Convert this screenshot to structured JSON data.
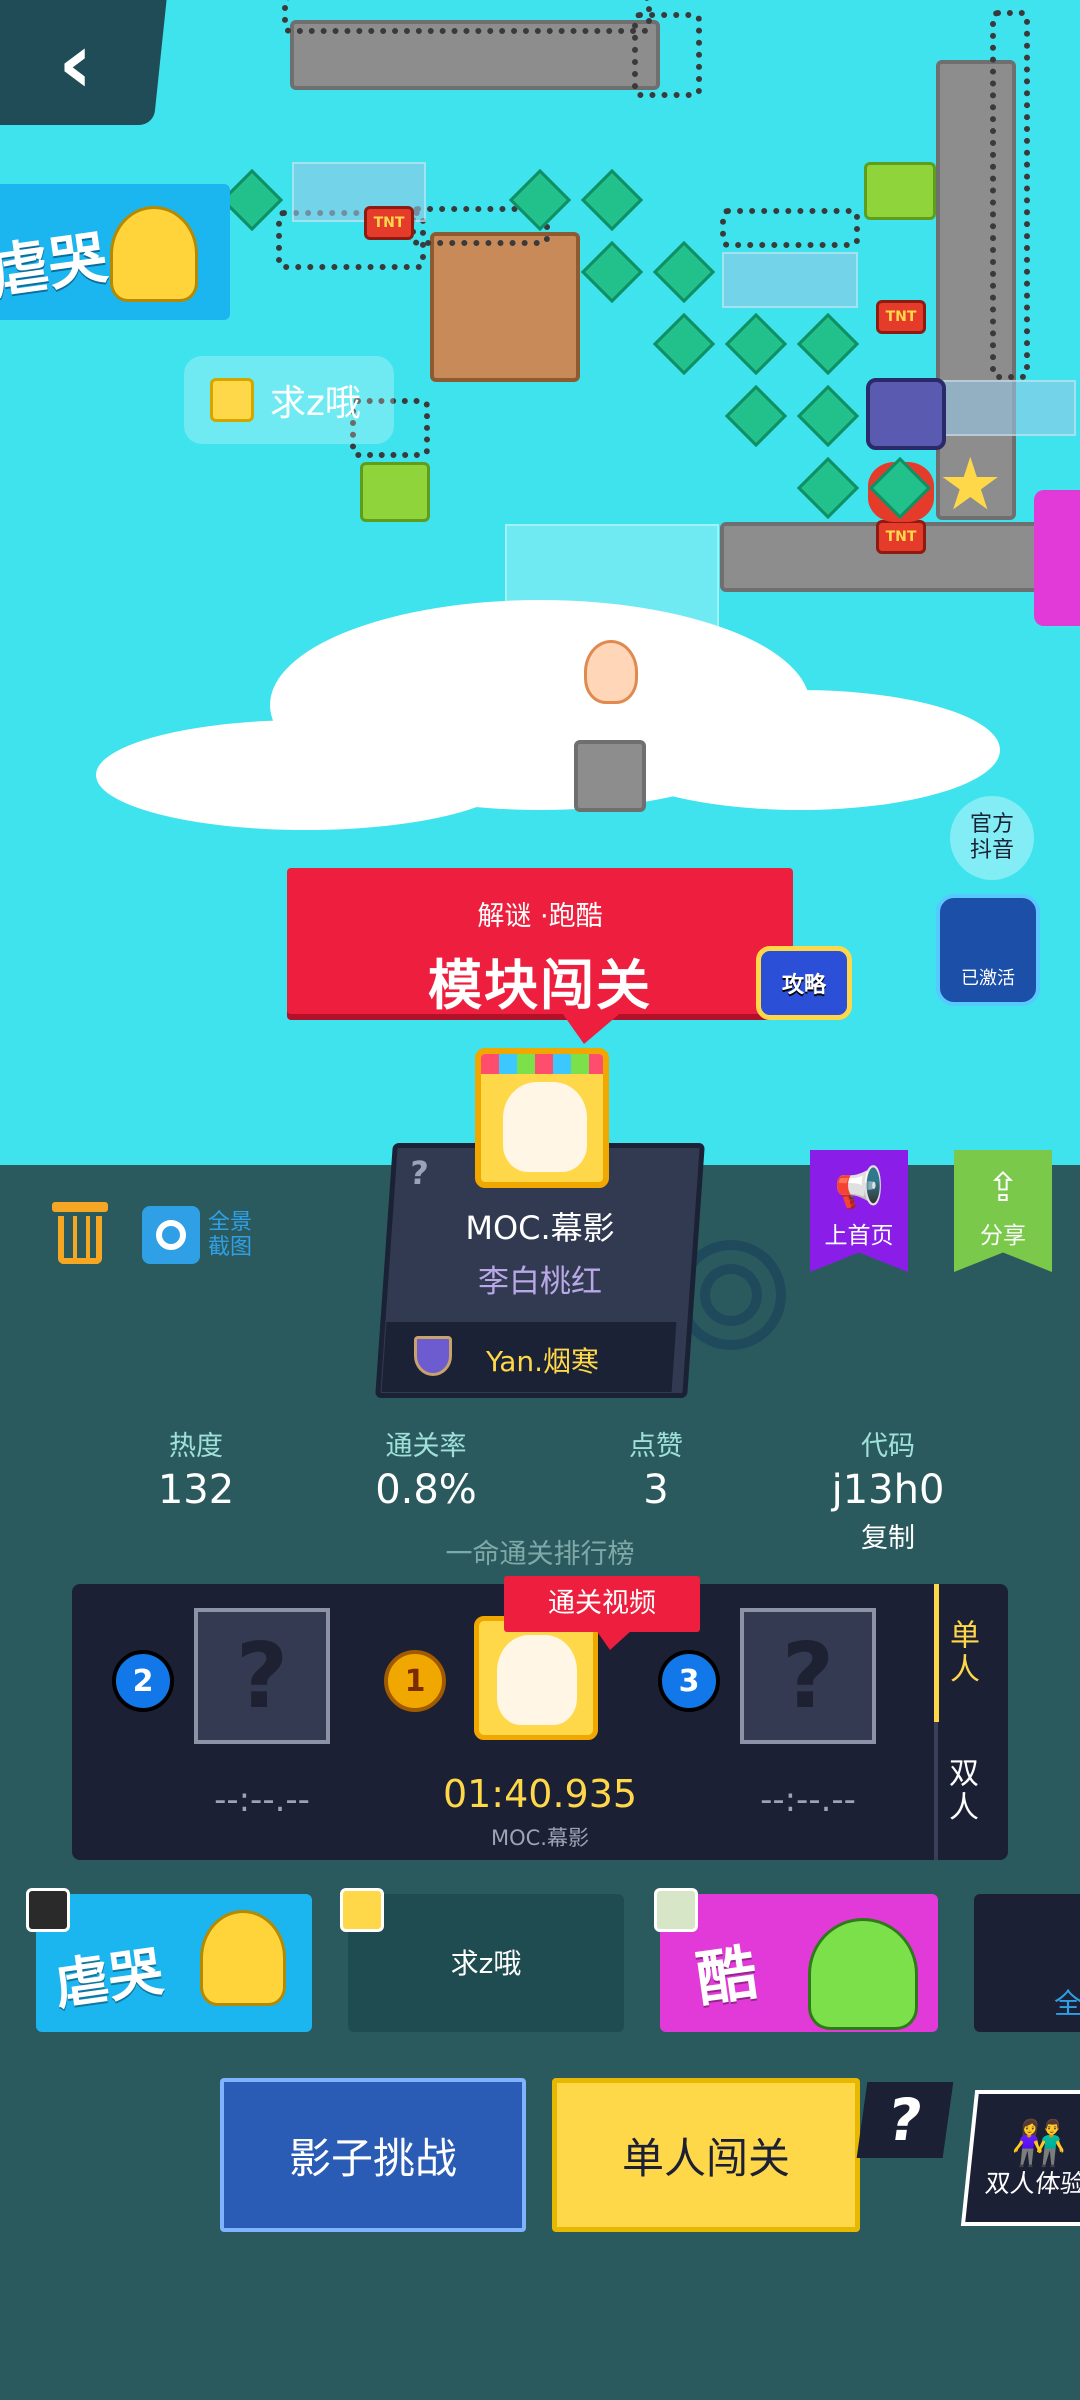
{
  "level": {
    "genre": "解谜 ·跑酷",
    "name": "模块闯关",
    "guide_label": "攻略"
  },
  "scene": {
    "cry_tag": "虐哭",
    "player_name": "求z哦",
    "official_label": "官方抖音",
    "activated_label": "已激活",
    "tnt_label": "TNT"
  },
  "creator": {
    "unknown_mark": "?",
    "name": "MOC.幕影",
    "title": "李白桃红",
    "coauthor": "Yan.烟寒"
  },
  "toolbar": {
    "screenshot_label": "全景截图",
    "homepage_label": "上首页",
    "share_label": "分享"
  },
  "stats": [
    {
      "label": "热度",
      "value": "132"
    },
    {
      "label": "通关率",
      "value": "0.8%"
    },
    {
      "label": "点赞",
      "value": "3"
    },
    {
      "label": "代码",
      "value": "j13h0"
    }
  ],
  "code_copy": "复制",
  "ranking": {
    "title": "一命通关排行榜",
    "video_label": "通关视频",
    "first": {
      "rank": "1",
      "time": "01:40.935",
      "name": "MOC.幕影"
    },
    "second": {
      "rank": "2",
      "time": "--:--.--"
    },
    "third": {
      "rank": "3",
      "time": "--:--.--"
    },
    "tab_single": "单人",
    "tab_double": "双人"
  },
  "tags": [
    {
      "label": "虐哭"
    },
    {
      "label": "求z哦"
    },
    {
      "label": "酷"
    },
    {
      "label": "全"
    }
  ],
  "buttons": {
    "shadow": "影子挑战",
    "solo": "单人闯关",
    "help": "?",
    "duo": "双人体验"
  },
  "colors": {
    "sky": "#3fe3ee",
    "panel": "#2b5a5e",
    "banner_red": "#ee1f3e",
    "gold": "#ffd84a",
    "purple": "#8a1ee8",
    "green": "#7ac94a"
  }
}
